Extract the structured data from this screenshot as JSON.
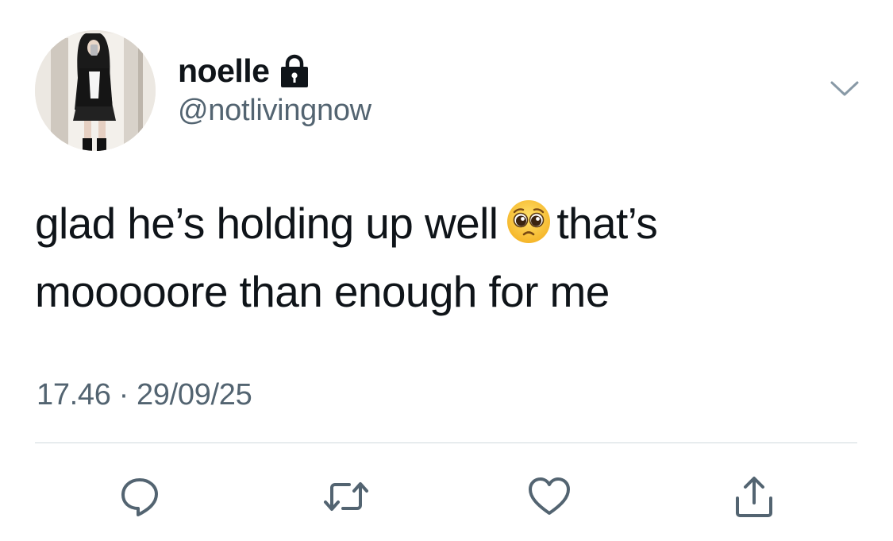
{
  "author": {
    "display_name": "noelle",
    "handle": "@notlivingnow",
    "protected_icon": "lock-icon",
    "avatar_icon": "profile-photo"
  },
  "menu_icon": "chevron-down-icon",
  "tweet": {
    "text_before_emoji": "glad he’s holding up well",
    "emoji": "🥺",
    "text_after_emoji": "that’s mooooore than enough for me"
  },
  "timestamp": {
    "time": "17.46",
    "separator": "·",
    "date": "29/09/25"
  },
  "actions": [
    {
      "name": "reply",
      "icon": "reply-icon"
    },
    {
      "name": "retweet",
      "icon": "retweet-icon"
    },
    {
      "name": "like",
      "icon": "heart-icon"
    },
    {
      "name": "share",
      "icon": "share-icon"
    }
  ],
  "colors": {
    "text_primary": "#0f1419",
    "text_secondary": "#536471",
    "divider": "#cfd9de",
    "icon": "#536471"
  }
}
